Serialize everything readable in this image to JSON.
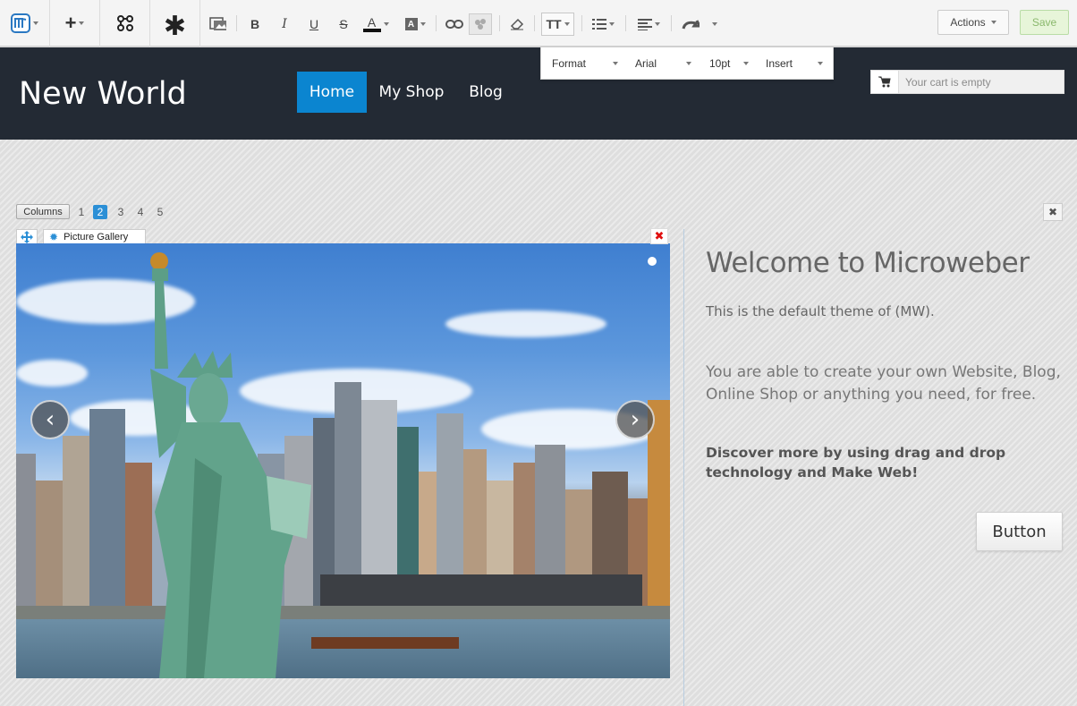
{
  "toolbar": {
    "format_panel": {
      "format_label": "Format",
      "font_label": "Arial",
      "size_label": "10pt",
      "insert_label": "Insert"
    },
    "actions_label": "Actions",
    "save_label": "Save",
    "tt_label": "TT"
  },
  "site": {
    "title": "New World",
    "nav": [
      {
        "label": "Home",
        "active": true
      },
      {
        "label": "My Shop",
        "active": false
      },
      {
        "label": "Blog",
        "active": false
      }
    ],
    "cart_placeholder": "Your cart is empty"
  },
  "layout_editor": {
    "columns_label": "Columns",
    "column_options": [
      "1",
      "2",
      "3",
      "4",
      "5"
    ],
    "selected_columns": "2"
  },
  "module": {
    "label": "Picture Gallery"
  },
  "welcome": {
    "title": "Welcome to Microweber",
    "paragraph1": "This is the default theme of (MW).",
    "paragraph2": "You are able to create your own Website, Blog, Online Shop or anything you need, for free.",
    "paragraph3": "Discover more by using drag and drop technology and Make Web!",
    "button_label": "Button"
  },
  "colors": {
    "header_bg": "#232a34",
    "nav_active": "#0b85d0",
    "save_bg": "#e7f5d9"
  }
}
